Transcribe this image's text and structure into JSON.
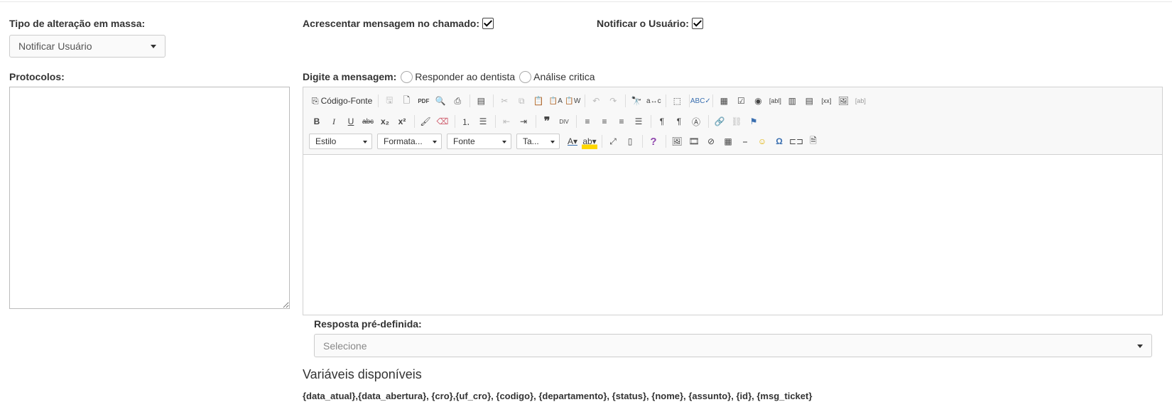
{
  "form": {
    "tipo_label": "Tipo de alteração em massa:",
    "tipo_value": "Notificar Usuário",
    "acrescentar_label": "Acrescentar mensagem no chamado:",
    "notificar_label": "Notificar o Usuário:",
    "acrescentar_checked": true,
    "notificar_checked": true,
    "protocolos_label": "Protocolos:",
    "protocolos_value": ""
  },
  "message": {
    "label": "Digite a mensagem:",
    "radio1": "Responder ao dentista",
    "radio2": "Análise critica"
  },
  "editor": {
    "source_label": "Código-Fonte",
    "combos": {
      "style": "Estilo",
      "format": "Formata...",
      "font": "Fonte",
      "size": "Ta..."
    },
    "content": ""
  },
  "resposta": {
    "label": "Resposta pré-definida:",
    "placeholder": "Selecione"
  },
  "variables": {
    "title": "Variáveis disponíveis",
    "list": "{data_atual},{data_abertura}, {cro},{uf_cro}, {codigo}, {departamento}, {status}, {nome}, {assunto}, {id}, {msg_ticket}"
  },
  "icons": [
    "save-icon",
    "new-page-icon",
    "pdf-icon",
    "preview-icon",
    "print-icon",
    "templates-icon",
    "cut-icon",
    "copy-icon",
    "paste-icon",
    "paste-text-icon",
    "paste-word-icon",
    "undo-icon",
    "redo-icon",
    "find-icon",
    "replace-icon",
    "select-all-icon",
    "spellcheck-icon",
    "form-icon",
    "checkbox-icon",
    "radio-icon",
    "textfield-icon",
    "textarea-icon",
    "select-icon",
    "button-icon",
    "imagebutton-icon",
    "hiddenfield-icon",
    "bold-icon",
    "italic-icon",
    "underline-icon",
    "strike-icon",
    "subscript-icon",
    "superscript-icon",
    "copy-format-icon",
    "remove-format-icon",
    "numbered-list-icon",
    "bulleted-list-icon",
    "outdent-icon",
    "indent-icon",
    "blockquote-icon",
    "div-icon",
    "align-left-icon",
    "align-center-icon",
    "align-right-icon",
    "justify-icon",
    "ltr-icon",
    "rtl-icon",
    "language-icon",
    "link-icon",
    "unlink-icon",
    "anchor-icon",
    "text-color-icon",
    "bg-color-icon",
    "maximize-icon",
    "show-blocks-icon",
    "about-icon",
    "image-icon",
    "flash-icon",
    "iframe-icon",
    "table-icon",
    "horizontal-line-icon",
    "smiley-icon",
    "special-char-icon",
    "page-break-icon",
    "placeholder-icon"
  ],
  "colors": {
    "accent": "#3a6fb0",
    "border": "#d1d1d1",
    "toolbar_bg": "#f8f8f8"
  }
}
